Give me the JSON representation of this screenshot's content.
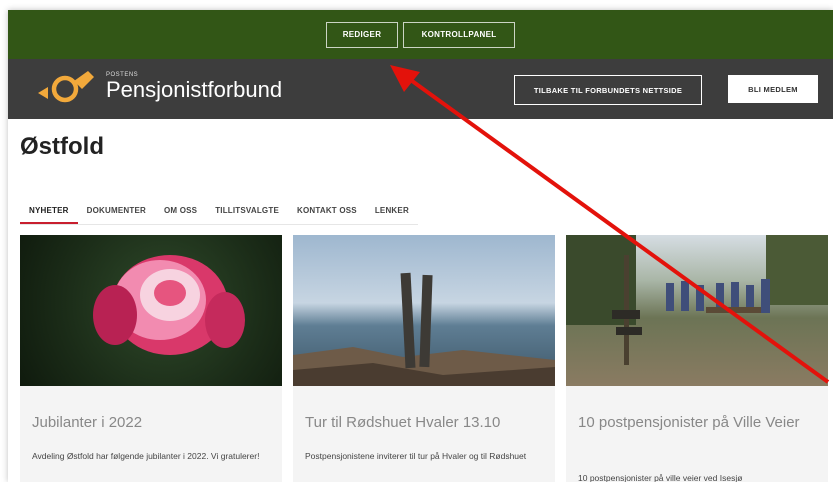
{
  "admin_bar": {
    "rediger": "REDIGER",
    "kontrollpanel": "KONTROLLPANEL"
  },
  "header": {
    "logo_small": "POSTENS",
    "logo_text": "Pensjonistforbund",
    "back_button": "TILBAKE TIL FORBUNDETS NETTSIDE",
    "join_button": "BLI MEDLEM"
  },
  "page_title": "Østfold",
  "tabs": [
    {
      "label": "NYHETER"
    },
    {
      "label": "DOKUMENTER"
    },
    {
      "label": "OM OSS"
    },
    {
      "label": "TILLITSVALGTE"
    },
    {
      "label": "KONTAKT OSS"
    },
    {
      "label": "LENKER"
    }
  ],
  "articles": [
    {
      "title": "Jubilanter i 2022",
      "excerpt": "Avdeling Østfold har følgende jubilanter i 2022. Vi gratulerer!"
    },
    {
      "title": "Tur til Rødshuet Hvaler 13.10",
      "excerpt": "Postpensjonistene inviterer til tur på Hvaler og til Rødshuet"
    },
    {
      "title": "10 postpensjonister på Ville Veier",
      "excerpt": "10 postpensjonister på ville veier ved Isesjø"
    }
  ],
  "colors": {
    "admin_bar": "#325616",
    "header": "#3d3d3d",
    "logo_accent": "#f2a93b",
    "tab_active": "#c81e2e",
    "annotation_arrow": "#e3120b"
  }
}
